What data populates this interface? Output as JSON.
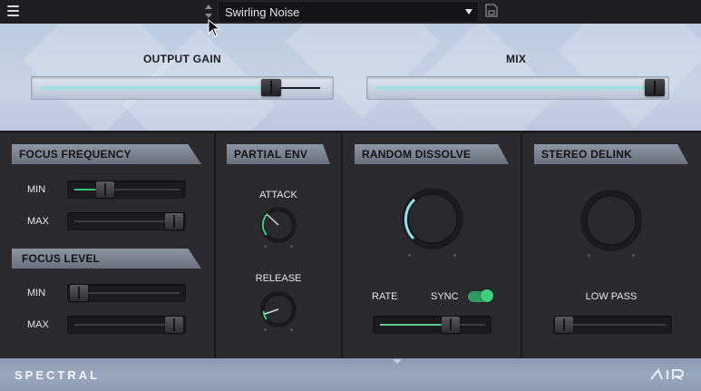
{
  "preset": {
    "name": "Swirling Noise"
  },
  "main": {
    "output_gain": {
      "label": "OUTPUT GAIN",
      "value": 0.8
    },
    "mix": {
      "label": "MIX",
      "value": 0.97
    }
  },
  "focus_frequency": {
    "title": "FOCUS FREQUENCY",
    "min_label": "MIN",
    "min_value": 0.3,
    "max_label": "MAX",
    "max_value": 0.98
  },
  "focus_level": {
    "title": "FOCUS LEVEL",
    "min_label": "MIN",
    "min_value": 0.05,
    "max_label": "MAX",
    "max_value": 0.98
  },
  "partial_env": {
    "title": "PARTIAL ENV",
    "attack_label": "ATTACK",
    "attack_value": 0.25,
    "release_label": "RELEASE",
    "release_value": 0.15
  },
  "random_dissolve": {
    "title": "RANDOM DISSOLVE",
    "amount_value": 0.28,
    "rate_label": "RATE",
    "sync_label": "SYNC",
    "sync_on": true,
    "rate_value": 0.62
  },
  "stereo_delink": {
    "title": "STEREO DELINK",
    "amount_value": 0.0,
    "low_pass_label": "LOW PASS",
    "low_pass_value": 0.0
  },
  "footer": {
    "title": "SPECTRAL"
  },
  "colors": {
    "accent_cyan": "#8fe3e8",
    "accent_green": "#35c37a",
    "panel": "#2b2b2f"
  },
  "icons": [
    "menu-icon",
    "up-arrow-icon",
    "down-arrow-icon",
    "dropdown-caret-icon",
    "save-icon",
    "air-logo"
  ]
}
